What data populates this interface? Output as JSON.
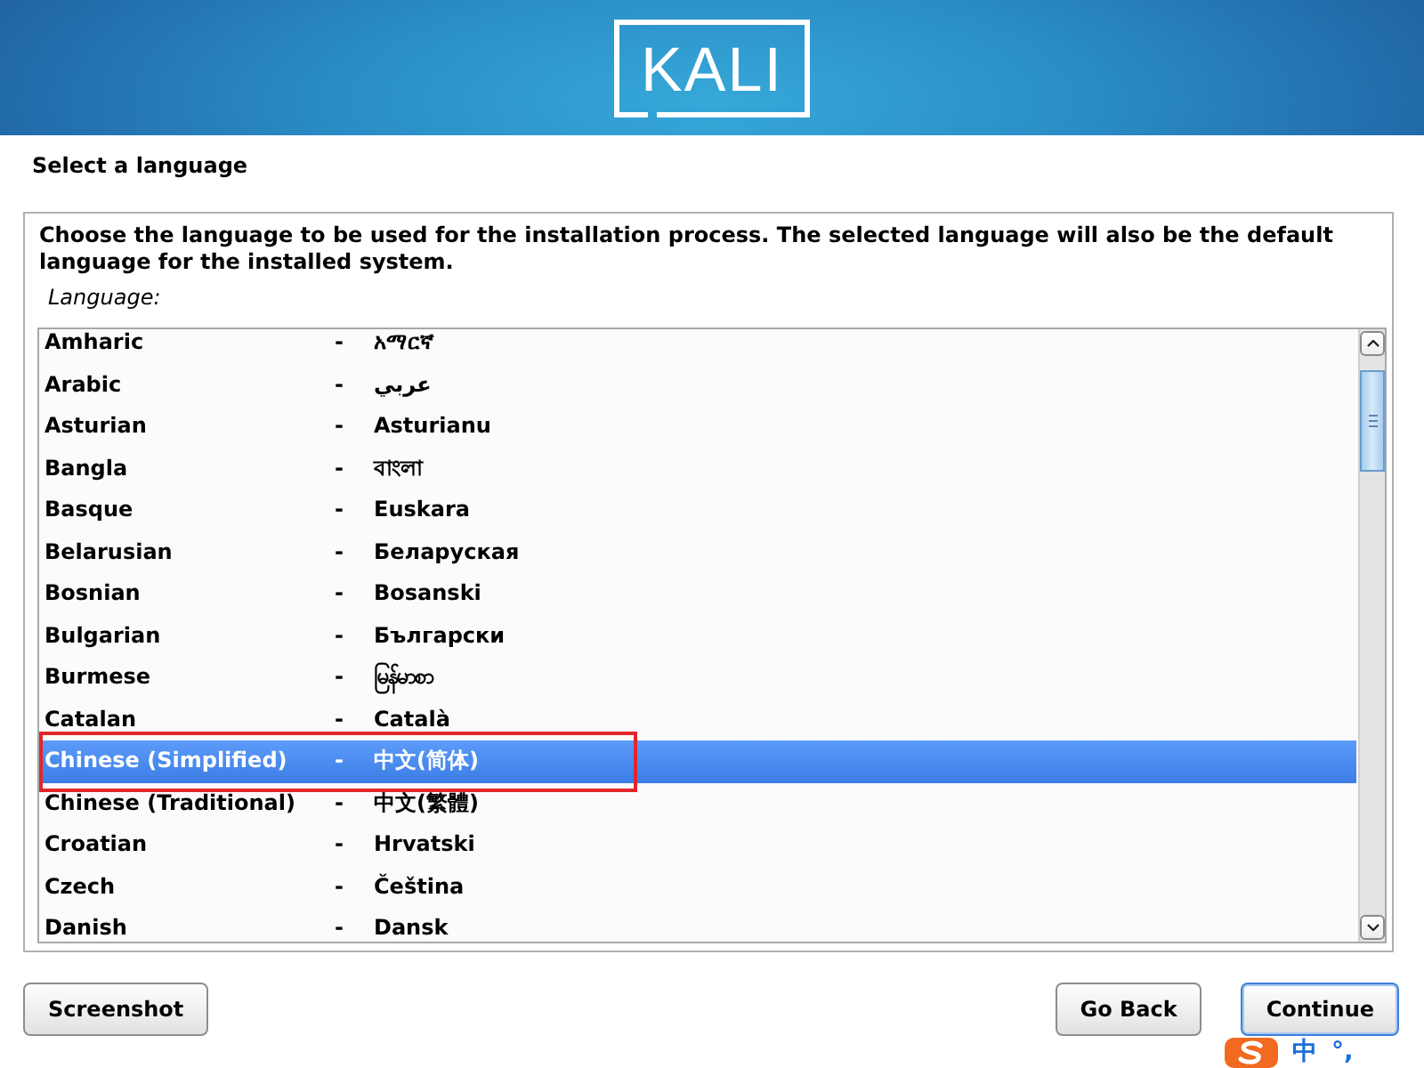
{
  "header": {
    "logo": "KALI"
  },
  "page_title": "Select a language",
  "panel": {
    "description": "Choose the language to be used for the installation process. The selected language will also be the default language for the installed system.",
    "list_label": "Language:",
    "languages": [
      {
        "name": "Amharic",
        "dash": "-",
        "native": "አማርኛ",
        "selected": false
      },
      {
        "name": "Arabic",
        "dash": "-",
        "native": "عربي",
        "selected": false
      },
      {
        "name": "Asturian",
        "dash": "-",
        "native": "Asturianu",
        "selected": false
      },
      {
        "name": "Bangla",
        "dash": "-",
        "native": "বাংলা",
        "selected": false
      },
      {
        "name": "Basque",
        "dash": "-",
        "native": "Euskara",
        "selected": false
      },
      {
        "name": "Belarusian",
        "dash": "-",
        "native": "Беларуская",
        "selected": false
      },
      {
        "name": "Bosnian",
        "dash": "-",
        "native": "Bosanski",
        "selected": false
      },
      {
        "name": "Bulgarian",
        "dash": "-",
        "native": "Български",
        "selected": false
      },
      {
        "name": "Burmese",
        "dash": "-",
        "native": "မြန်မာစာ",
        "selected": false
      },
      {
        "name": "Catalan",
        "dash": "-",
        "native": "Català",
        "selected": false
      },
      {
        "name": "Chinese (Simplified)",
        "dash": "-",
        "native": "中文(简体)",
        "selected": true
      },
      {
        "name": "Chinese (Traditional)",
        "dash": "-",
        "native": "中文(繁體)",
        "selected": false
      },
      {
        "name": "Croatian",
        "dash": "-",
        "native": "Hrvatski",
        "selected": false
      },
      {
        "name": "Czech",
        "dash": "-",
        "native": "Čeština",
        "selected": false
      },
      {
        "name": "Danish",
        "dash": "-",
        "native": "Dansk",
        "selected": false
      }
    ]
  },
  "buttons_left": [
    {
      "label": "Screenshot",
      "focused": false
    }
  ],
  "buttons_right": [
    {
      "label": "Go Back",
      "focused": false
    },
    {
      "label": "Continue",
      "focused": true
    }
  ],
  "ime_toolbar": {
    "mode": "中",
    "punctuation": "°,"
  }
}
